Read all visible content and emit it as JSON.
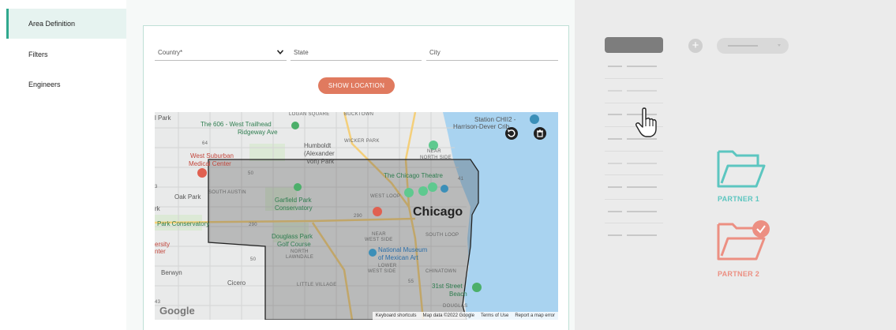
{
  "sidebar": {
    "items": [
      {
        "label": "Area Definition",
        "active": true
      },
      {
        "label": "Filters",
        "active": false
      },
      {
        "label": "Engineers",
        "active": false
      }
    ]
  },
  "form": {
    "country_placeholder": "Country*",
    "state_placeholder": "State",
    "city_placeholder": "City",
    "show_location_label": "SHOW LOCATION"
  },
  "map": {
    "labels": {
      "park_left": "l Park",
      "the606": "The 606 - West Trailhead",
      "ridgeway": "Ridgeway Ave",
      "logan_square": "LOGAN SQUARE",
      "bucktown": "BUCKTOWN",
      "wicker_park": "WICKER PARK",
      "humboldt1": "Humboldt",
      "humboldt2": "(Alexander",
      "humboldt3": "Von) Park",
      "west_suburban1": "West Suburban",
      "west_suburban2": "Medical Center",
      "near_north1": "NEAR",
      "near_north2": "NORTH SIDE",
      "station1": "Station CHII2 -",
      "station2": "Harrison-Dever Crib",
      "chicago_theatre": "The Chicago Theatre",
      "south_austin": "SOUTH AUSTIN",
      "oak_park": "Oak Park",
      "garfield1": "Garfield Park",
      "garfield2": "Conservatory",
      "west_loop": "WEST LOOP",
      "rk": "rk",
      "chicago": "Chicago",
      "park_conservatory": "Park Conservatory",
      "douglass1": "Douglass Park",
      "douglass2": "Golf Course",
      "near_west1": "NEAR",
      "near_west2": "WEST SIDE",
      "south_loop": "SOUTH LOOP",
      "ersity1": "ersity",
      "ersity2": "nter",
      "north_lawndale1": "NORTH",
      "north_lawndale2": "LAWNDALE",
      "museum1": "National Museum",
      "museum2": "of Mexican Art",
      "lower_west1": "LOWER",
      "lower_west2": "WEST SIDE",
      "chinatown": "CHINATOWN",
      "berwyn": "Berwyn",
      "cicero": "Cicero",
      "little_village": "LITTLE VILLAGE",
      "beach1": "31st Street",
      "beach2": "Beach",
      "douglas": "DOUGLAS",
      "route64": "64",
      "route50a": "50",
      "route50b": "50",
      "route290a": "290",
      "route290b": "290",
      "route41": "41",
      "route43": "43",
      "route55": "55",
      "route3": "3"
    },
    "attribution": {
      "keyboard": "Keyboard shortcuts",
      "data": "Map data ©2022 Google",
      "terms": "Terms of Use",
      "report": "Report a map error"
    },
    "google_logo": "Google"
  },
  "right_panel": {
    "partner1": "PARTNER 1",
    "partner2": "PARTNER 2"
  },
  "colors": {
    "accent_teal": "#2fa88e",
    "folder_teal": "#5cc6c0",
    "folder_salmon": "#ec8f82",
    "button_orange": "#e07a5f"
  }
}
